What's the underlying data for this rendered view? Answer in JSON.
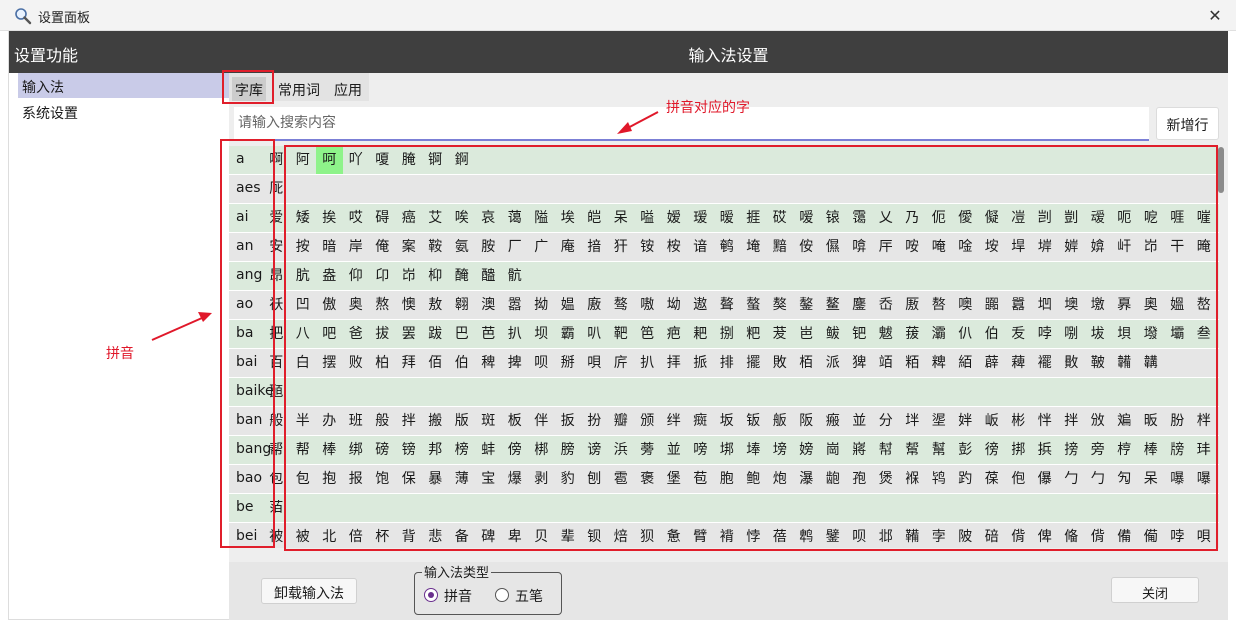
{
  "window": {
    "title": "设置面板",
    "close_glyph": "✕",
    "app_icon": "magnifier-icon"
  },
  "sidebar": {
    "title": "设置功能",
    "items": [
      {
        "label": "输入法",
        "selected": true
      },
      {
        "label": "系统设置",
        "selected": false
      }
    ]
  },
  "main": {
    "title": "输入法设置",
    "tabs": [
      {
        "label": "字库",
        "selected": true
      },
      {
        "label": "常用词",
        "selected": false
      },
      {
        "label": "应用",
        "selected": false
      }
    ],
    "search": {
      "placeholder": "请输入搜索内容",
      "value": ""
    },
    "add_row_label": "新增行",
    "rows": [
      {
        "pinyin": "a",
        "chars": "啊阿呵吖嗄腌锕錒",
        "highlight": [
          2
        ]
      },
      {
        "pinyin": "aes",
        "chars": "厑",
        "highlight": []
      },
      {
        "pinyin": "ai",
        "chars": "爱矮挨哎碍癌艾唉哀蔼隘埃皑呆嗌嫒瑷暧捱砹嗳锿霭乂乃伌僾儗凒剀剴叆呃呝啀嘊",
        "highlight": []
      },
      {
        "pinyin": "an",
        "chars": "安按暗岸俺案鞍氨胺厂广庵揞犴铵桉谙鹌埯黯侒儑啽厈咹唵唫垵垾堓婩媕屽岇干晻",
        "highlight": []
      },
      {
        "pinyin": "ang",
        "chars": "昂肮盎仰卬岇枊醃醠骯",
        "highlight": []
      },
      {
        "pinyin": "ao",
        "chars": "袄凹傲奥熬懊敖翱澳嚣拗媪廒骜嗷坳遨聱螯獒鏊鳌鏖岙厫嗸噢嚻囂垇墺墽奡奧媼嶅",
        "highlight": []
      },
      {
        "pinyin": "ba",
        "chars": "把八吧爸拔罢跋巴芭扒坝霸叭靶笆疤耙捌粑茇岜鲅钯魃菝灞仈伯叐哱哵坺垻墢壩叁",
        "highlight": []
      },
      {
        "pinyin": "bai",
        "chars": "百白摆败柏拜佰伯稗捭呗掰唄庍扒拝挀排擺敗栢派猈竡粨粺絔薜薭襬贁鞁韛韝",
        "highlight": []
      },
      {
        "pinyin": "baike",
        "chars": "瓸",
        "highlight": []
      },
      {
        "pinyin": "ban",
        "chars": "般半办班般拌搬版斑板伴扳扮瓣颁绊癍坂钣舨阪瘢並分坢埿姅岅彬怑拌攽斒昄朌柈",
        "highlight": []
      },
      {
        "pinyin": "bang",
        "chars": "帮帮棒绑磅镑邦榜蚌傍梆膀谤浜蒡並嗙垹埲塝嫎崗嶈幇幚幫彭徬挷捠搒旁梈棒牓玤碰",
        "highlight": []
      },
      {
        "pinyin": "bao",
        "chars": "包包抱报饱保暴薄宝爆剥豹刨雹褒堡苞胞鲍炮瀑龅孢煲褓鸨趵葆佨儤勹勹勼呆嚗嚗",
        "highlight": []
      },
      {
        "pinyin": "be",
        "chars": "萡",
        "highlight": []
      },
      {
        "pinyin": "bei",
        "chars": "被被北倍杯背悲备碑卑贝辈钡焙狈惫臂褙悖蓓鹎鐾呗邶鞴孛陂碚偝俾偹偝備僃哱唄",
        "highlight": []
      }
    ]
  },
  "footer": {
    "unload_label": "卸载输入法",
    "type_legend": "输入法类型",
    "options": [
      {
        "label": "拼音",
        "checked": true
      },
      {
        "label": "五笔",
        "checked": false
      }
    ],
    "close_label": "关闭"
  },
  "annotations": {
    "chars_note": "拼音对应的字",
    "pinyin_note": "拼音",
    "color": "#e0182a"
  },
  "colors": {
    "header": "#3f3f3f",
    "row_odd": "#dbeadc",
    "row_even": "#e6e6e6",
    "highlight": "#8ef38a",
    "accent": "#6a2f8e"
  }
}
